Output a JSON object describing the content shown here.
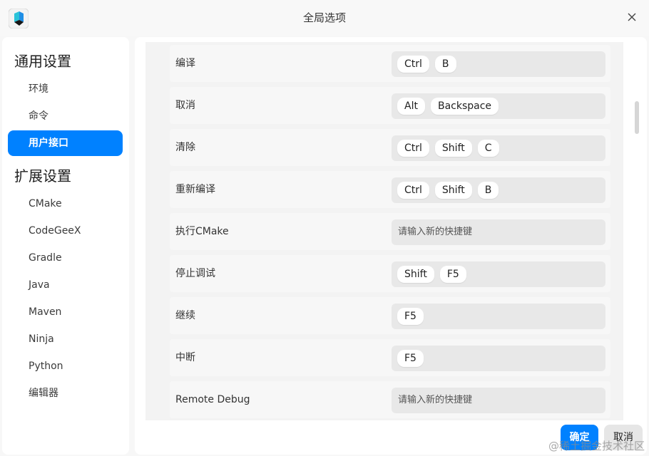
{
  "window": {
    "title": "全局选项"
  },
  "sidebar": {
    "groups": [
      {
        "title": "通用设置",
        "items": [
          "环境",
          "命令",
          "用户接口"
        ]
      },
      {
        "title": "扩展设置",
        "items": [
          "CMake",
          "CodeGeeX",
          "Gradle",
          "Java",
          "Maven",
          "Ninja",
          "Python",
          "编辑器"
        ]
      }
    ],
    "selected": "用户接口"
  },
  "shortcuts": [
    {
      "label": "编译",
      "keys": [
        "Ctrl",
        "B"
      ],
      "placeholder": ""
    },
    {
      "label": "取消",
      "keys": [
        "Alt",
        "Backspace"
      ],
      "placeholder": ""
    },
    {
      "label": "清除",
      "keys": [
        "Ctrl",
        "Shift",
        "C"
      ],
      "placeholder": ""
    },
    {
      "label": "重新编译",
      "keys": [
        "Ctrl",
        "Shift",
        "B"
      ],
      "placeholder": ""
    },
    {
      "label": "执行CMake",
      "keys": [],
      "placeholder": "请输入新的快捷键"
    },
    {
      "label": "停止调试",
      "keys": [
        "Shift",
        "F5"
      ],
      "placeholder": ""
    },
    {
      "label": "继续",
      "keys": [
        "F5"
      ],
      "placeholder": ""
    },
    {
      "label": "中断",
      "keys": [
        "F5"
      ],
      "placeholder": ""
    },
    {
      "label": "Remote Debug",
      "keys": [],
      "placeholder": "请输入新的快捷键"
    }
  ],
  "buttons": {
    "ok": "确定",
    "cancel": "取消"
  },
  "watermark": "@稀土掘金技术社区",
  "colors": {
    "accent": "#0081ff",
    "panel": "#ffffff",
    "row": "#f7f7f7",
    "key_box": "#e8e8e8"
  }
}
